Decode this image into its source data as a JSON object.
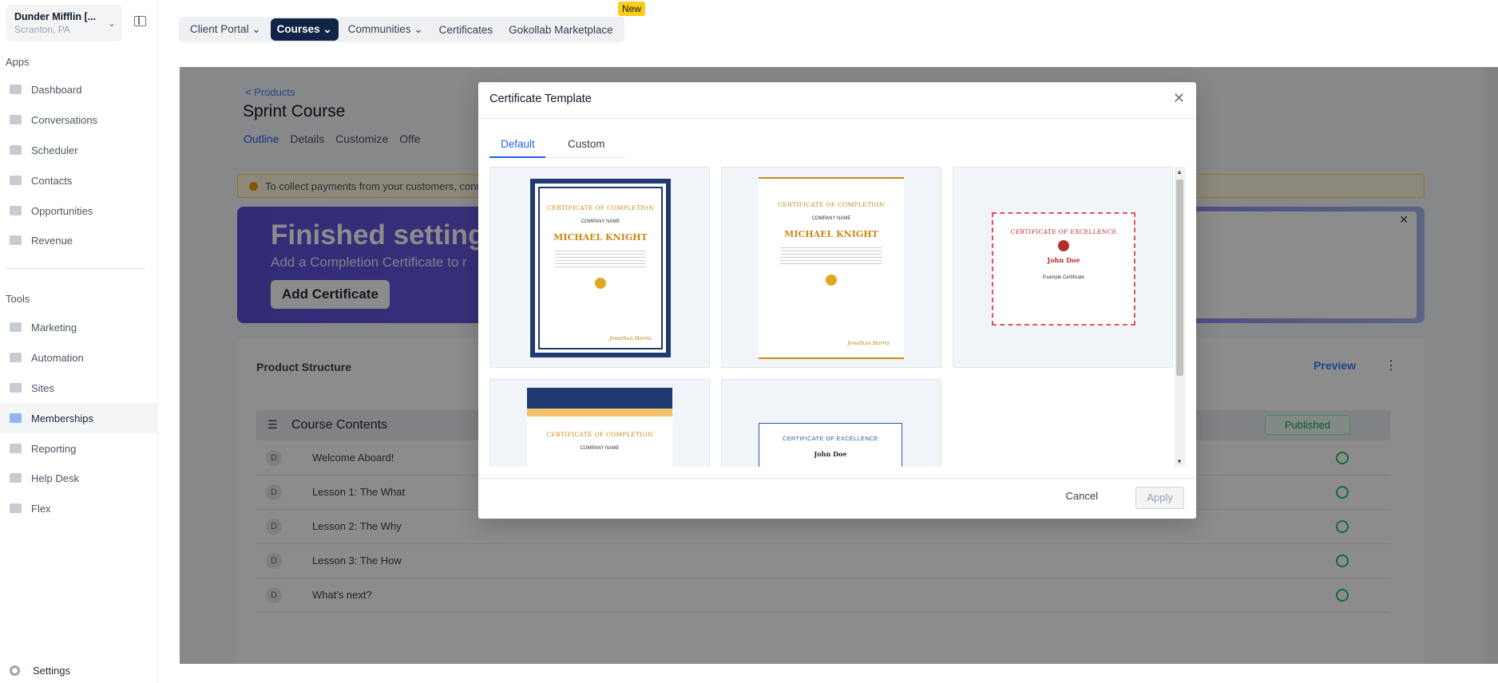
{
  "account": {
    "name": "Dunder Mifflin [...",
    "location": "Scranton, PA"
  },
  "sidebar": {
    "apps_label": "Apps",
    "tools_label": "Tools",
    "apps": [
      {
        "label": "Dashboard",
        "icon": "dashboard-icon"
      },
      {
        "label": "Conversations",
        "icon": "chat-icon"
      },
      {
        "label": "Scheduler",
        "icon": "calendar-icon"
      },
      {
        "label": "Contacts",
        "icon": "person-icon"
      },
      {
        "label": "Opportunities",
        "icon": "target-icon"
      },
      {
        "label": "Revenue",
        "icon": "card-icon"
      }
    ],
    "tools": [
      {
        "label": "Marketing",
        "icon": "megaphone-icon"
      },
      {
        "label": "Automation",
        "icon": "cog-icon"
      },
      {
        "label": "Sites",
        "icon": "globe-icon"
      },
      {
        "label": "Memberships",
        "icon": "members-icon"
      },
      {
        "label": "Reporting",
        "icon": "pie-icon"
      },
      {
        "label": "Help Desk",
        "icon": "help-icon"
      },
      {
        "label": "Flex",
        "icon": "flex-icon"
      }
    ],
    "settings_label": "Settings"
  },
  "topnav": {
    "tabs": [
      "Client Portal",
      "Courses",
      "Communities",
      "Certificates",
      "Gokollab Marketplace"
    ],
    "new_badge": "New"
  },
  "page": {
    "breadcrumb": "< Products",
    "title": "Sprint Course",
    "subtabs": [
      "Outline",
      "Details",
      "Customize",
      "Offe"
    ],
    "alert": "To collect payments from your customers, conne",
    "banner_title": "Finished setting",
    "banner_sub": "Add a Completion Certificate to r",
    "banner_button": "Add Certificate",
    "structure_title": "Product Structure",
    "preview_label": "Preview",
    "course_contents": "Course Contents",
    "published": "Published",
    "lessons": [
      "Welcome Aboard!",
      "Lesson 1: The What",
      "Lesson 2: The Why",
      "Lesson 3: The How",
      "What's next?"
    ],
    "lesson_badge": "D"
  },
  "modal": {
    "title": "Certificate Template",
    "tabs": [
      "Default",
      "Custom"
    ],
    "cancel": "Cancel",
    "apply": "Apply",
    "templates": [
      {
        "heading": "CERTIFICATE OF COMPLETION",
        "company": "COMPANY NAME",
        "name": "MICHAEL KNIGHT",
        "signature": "Jonathan Harris"
      },
      {
        "heading": "CERTIFICATE OF COMPLETION",
        "company": "COMPANY NAME",
        "name": "MICHAEL KNIGHT",
        "signature": "Jonathan Harris"
      },
      {
        "heading": "CERTIFICATE OF EXCELLENCE",
        "name": "John Doe",
        "company": "Example Certificate"
      },
      {
        "heading": "CERTIFICATE OF COMPLETION",
        "company": "COMPANY NAME"
      },
      {
        "heading": "CERTIFICATE OF EXCELLENCE",
        "name": "John Doe"
      }
    ]
  }
}
